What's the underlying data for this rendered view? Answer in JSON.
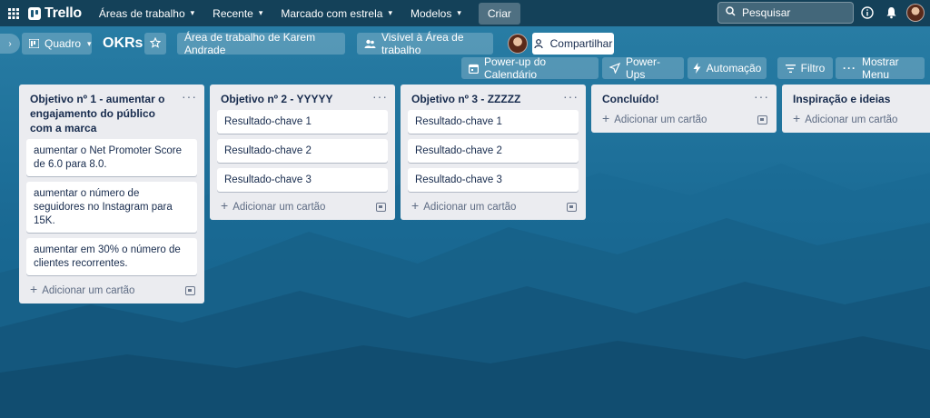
{
  "topnav": {
    "logo_text": "Trello",
    "items": [
      {
        "label": "Áreas de trabalho"
      },
      {
        "label": "Recente"
      },
      {
        "label": "Marcado com estrela"
      },
      {
        "label": "Modelos"
      }
    ],
    "create_label": "Criar",
    "search_label": "Pesquisar"
  },
  "board": {
    "view_label": "Quadro",
    "title": "OKRs",
    "workspace_label": "Área de trabalho de Karem Andrade",
    "visibility_label": "Visível à Área de trabalho",
    "share_label": "Compartilhar",
    "powerup_label": "Power-up do Calendário",
    "powerups_label": "Power-Ups",
    "automation_label": "Automação",
    "filter_label": "Filtro",
    "menu_label": "Mostrar Menu"
  },
  "lists": [
    {
      "title": "Objetivo nº 1 - aumentar o engajamento do público com a marca",
      "cards": [
        "aumentar o Net Promoter Score de 6.0 para 8.0.",
        "aumentar o número de seguidores no Instagram para 15K.",
        "aumentar em 30% o número de clientes recorrentes."
      ],
      "add_label": "Adicionar um cartão"
    },
    {
      "title": "Objetivo nº 2 - YYYYY",
      "cards": [
        "Resultado-chave 1",
        "Resultado-chave 2",
        "Resultado-chave 3"
      ],
      "add_label": "Adicionar um cartão"
    },
    {
      "title": "Objetivo nº 3 - ZZZZZ",
      "cards": [
        "Resultado-chave 1",
        "Resultado-chave 2",
        "Resultado-chave 3"
      ],
      "add_label": "Adicionar um cartão"
    },
    {
      "title": "Concluído!",
      "cards": [],
      "add_label": "Adicionar um cartão"
    },
    {
      "title": "Inspiração e ideias",
      "cards": [],
      "add_label": "Adicionar um cartão"
    }
  ],
  "colors": {
    "topnav_bg": "#123c52",
    "list_bg": "#ebecf0",
    "card_bg": "#ffffff",
    "text": "#172b4d"
  }
}
